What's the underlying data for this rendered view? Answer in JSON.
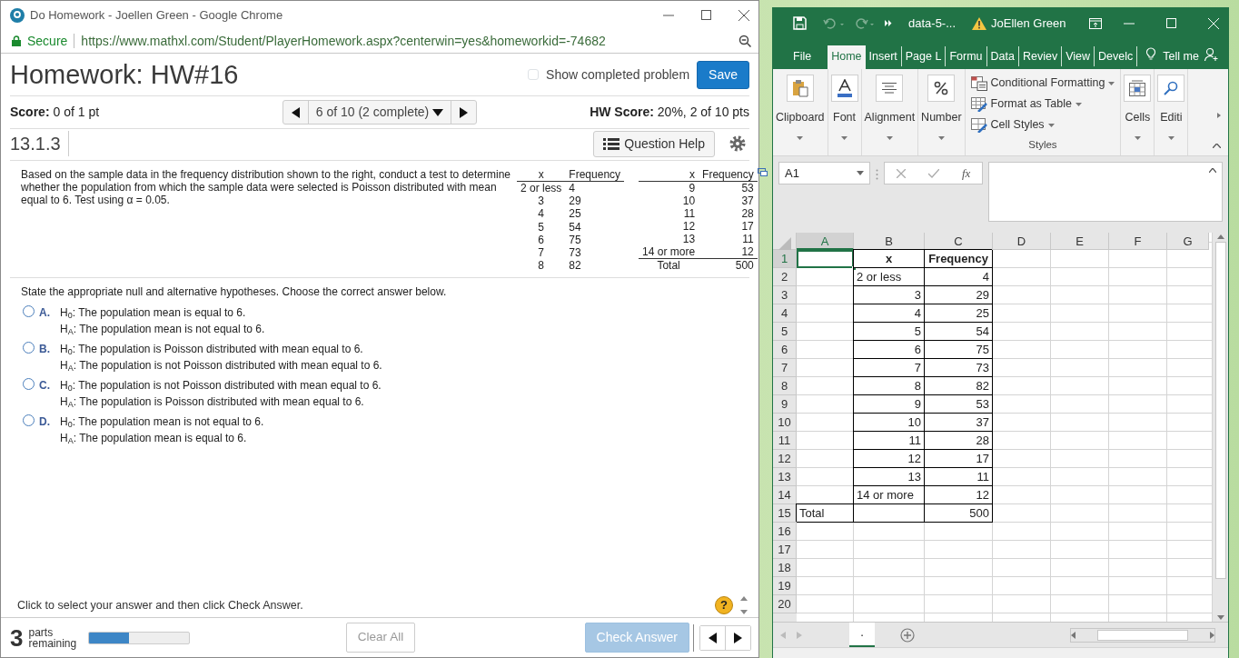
{
  "browser": {
    "title": "Do Homework - Joellen Green - Google Chrome",
    "secure_label": "Secure",
    "url": "https://www.mathxl.com/Student/PlayerHomework.aspx?centerwin=yes&homeworkid=-74682"
  },
  "homework": {
    "title": "Homework: HW#16",
    "show_completed": {
      "label": "Show completed problem",
      "checked": false
    },
    "save": "Save",
    "score": "**Score:** 0 of 1 pt",
    "question_nav": "6 of 10 (2 complete)",
    "hw_score": "**HW Score:** 20%, 2 of 10 pts",
    "question_id": "13.1.3",
    "question_help": "Question Help",
    "question_text": "Based on the sample data in the frequency distribution shown to the right, conduct a test to determine whether the population from which the sample data were selected is Poisson distributed with mean equal to 6. Test using α = 0.05.",
    "freq_table": {
      "left_columns": [
        "x",
        "Frequency"
      ],
      "right_columns": [
        "x",
        "Frequency"
      ],
      "left_rows": [
        [
          "2 or less",
          "4"
        ],
        [
          "3",
          "29"
        ],
        [
          "4",
          "25"
        ],
        [
          "5",
          "54"
        ],
        [
          "6",
          "75"
        ],
        [
          "7",
          "73"
        ],
        [
          "8",
          "82"
        ]
      ],
      "right_rows": [
        [
          "9",
          "53"
        ],
        [
          "10",
          "37"
        ],
        [
          "11",
          "28"
        ],
        [
          "12",
          "17"
        ],
        [
          "13",
          "11"
        ],
        [
          "14 or more",
          "12"
        ]
      ],
      "total": [
        "Total",
        "500"
      ]
    },
    "prompt": "State the appropriate null and alternative hypotheses. Choose the correct answer below.",
    "options": [
      {
        "letter": "A.",
        "h0": "H$_{0}$: The population mean is equal to 6.",
        "ha": "H$_{A}$: The population mean is not equal to 6.",
        "selected": false
      },
      {
        "letter": "B.",
        "h0": "H$_{0}$: The population is Poisson distributed with mean equal to 6.",
        "ha": "H$_{A}$: The population is not Poisson distributed with mean equal to 6.",
        "selected": false
      },
      {
        "letter": "C.",
        "h0": "H$_{0}$: The population is not Poisson distributed with mean equal to 6.",
        "ha": "H$_{A}$: The population is Poisson distributed with mean equal to 6.",
        "selected": false
      },
      {
        "letter": "D.",
        "h0": "H$_{0}$: The population mean is not equal to 6.",
        "ha": "H$_{A}$: The population mean is equal to 6.",
        "selected": false
      }
    ],
    "instruction": "Click to select your answer and then click Check Answer.",
    "help": "?",
    "parts_count": "3",
    "parts_label": "parts remaining",
    "progress": {
      "level": 0.4
    },
    "clear_all": "Clear All",
    "check_answer": {
      "label": "Check Answer",
      "disabled": true
    }
  },
  "excel": {
    "file": "data-5-...",
    "user": "JoEllen Green",
    "tabs": [
      {
        "label": "File",
        "selected": false
      },
      {
        "label": "Home",
        "selected": true
      },
      {
        "label": "Insert",
        "selected": false
      },
      {
        "label": "Page L",
        "selected": false
      },
      {
        "label": "Formu",
        "selected": false
      },
      {
        "label": "Data",
        "selected": false
      },
      {
        "label": "Reviev",
        "selected": false
      },
      {
        "label": "View",
        "selected": false
      },
      {
        "label": "Develc",
        "selected": false
      }
    ],
    "tell_me": "Tell me",
    "groups": [
      {
        "kind": "button",
        "label": "Clipboard"
      },
      {
        "kind": "button",
        "label": "Font"
      },
      {
        "kind": "button",
        "label": "Alignment"
      },
      {
        "kind": "button",
        "label": "Number"
      },
      {
        "kind": "list",
        "label": "Styles",
        "items": [
          "Conditional Formatting",
          "Format as Table",
          "Cell Styles"
        ]
      },
      {
        "kind": "button",
        "label": "Cells"
      },
      {
        "kind": "button",
        "label": "Editi"
      }
    ],
    "name_box": "A1",
    "function_label": "fx",
    "columns": [
      {
        "label": "A",
        "selected": true
      },
      {
        "label": "B",
        "selected": false
      },
      {
        "label": "C",
        "selected": false
      },
      {
        "label": "D",
        "selected": false
      },
      {
        "label": "E",
        "selected": false
      },
      {
        "label": "F",
        "selected": false
      },
      {
        "label": "G",
        "selected": false
      }
    ],
    "rows": [
      {
        "number": "1",
        "selected": true,
        "b": {
          "text": "x",
          "kind": "header"
        },
        "c": {
          "text": "Frequency",
          "kind": "header"
        }
      },
      {
        "number": "2",
        "selected": false,
        "b": {
          "text": "2 or less",
          "kind": "text"
        },
        "c": {
          "text": "4",
          "kind": "number"
        }
      },
      {
        "number": "3",
        "selected": false,
        "b": {
          "text": "3",
          "kind": "number"
        },
        "c": {
          "text": "29",
          "kind": "number"
        }
      },
      {
        "number": "4",
        "selected": false,
        "b": {
          "text": "4",
          "kind": "number"
        },
        "c": {
          "text": "25",
          "kind": "number"
        }
      },
      {
        "number": "5",
        "selected": false,
        "b": {
          "text": "5",
          "kind": "number"
        },
        "c": {
          "text": "54",
          "kind": "number"
        }
      },
      {
        "number": "6",
        "selected": false,
        "b": {
          "text": "6",
          "kind": "number"
        },
        "c": {
          "text": "75",
          "kind": "number"
        }
      },
      {
        "number": "7",
        "selected": false,
        "b": {
          "text": "7",
          "kind": "number"
        },
        "c": {
          "text": "73",
          "kind": "number"
        }
      },
      {
        "number": "8",
        "selected": false,
        "b": {
          "text": "8",
          "kind": "number"
        },
        "c": {
          "text": "82",
          "kind": "number"
        }
      },
      {
        "number": "9",
        "selected": false,
        "b": {
          "text": "9",
          "kind": "number"
        },
        "c": {
          "text": "53",
          "kind": "number"
        }
      },
      {
        "number": "10",
        "selected": false,
        "b": {
          "text": "10",
          "kind": "number"
        },
        "c": {
          "text": "37",
          "kind": "number"
        }
      },
      {
        "number": "11",
        "selected": false,
        "b": {
          "text": "11",
          "kind": "number"
        },
        "c": {
          "text": "28",
          "kind": "number"
        }
      },
      {
        "number": "12",
        "selected": false,
        "b": {
          "text": "12",
          "kind": "number"
        },
        "c": {
          "text": "17",
          "kind": "number"
        }
      },
      {
        "number": "13",
        "selected": false,
        "b": {
          "text": "13",
          "kind": "number"
        },
        "c": {
          "text": "11",
          "kind": "number"
        }
      },
      {
        "number": "14",
        "selected": false,
        "b": {
          "text": "14 or more",
          "kind": "text"
        },
        "c": {
          "text": "12",
          "kind": "number"
        }
      },
      {
        "number": "15",
        "selected": false,
        "a": {
          "text": "Total",
          "kind": "text"
        },
        "c": {
          "text": "500",
          "kind": "number"
        }
      },
      {
        "number": "16",
        "selected": false
      },
      {
        "number": "17",
        "selected": false
      },
      {
        "number": "18",
        "selected": false
      },
      {
        "number": "19",
        "selected": false
      },
      {
        "number": "20",
        "selected": false
      }
    ],
    "sheet_tab": "."
  }
}
